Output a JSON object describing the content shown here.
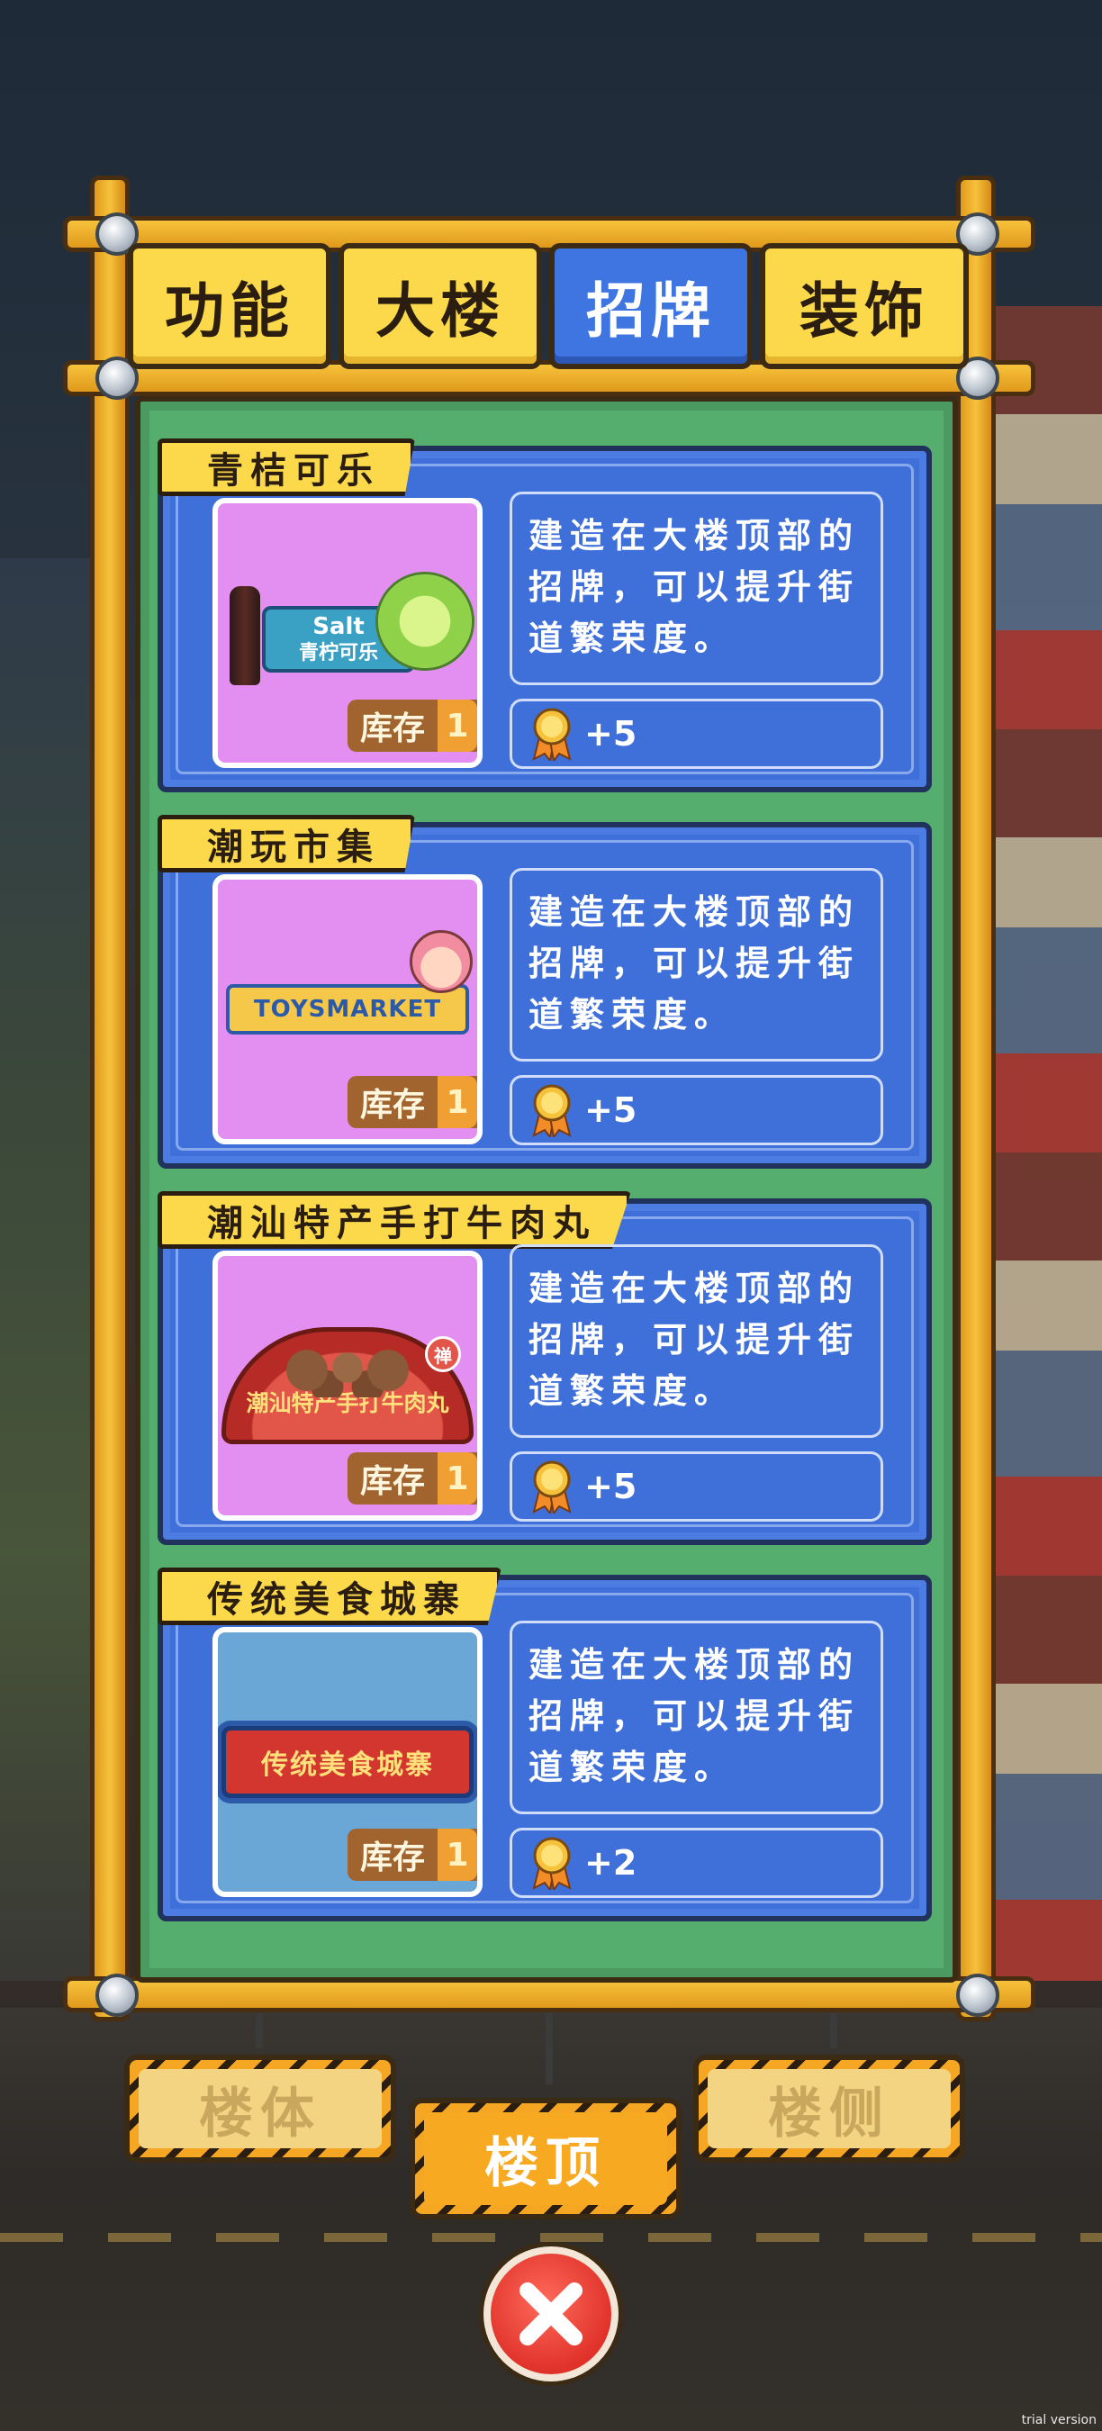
{
  "tabs": [
    {
      "label": "功能",
      "active": false
    },
    {
      "label": "大楼",
      "active": false
    },
    {
      "label": "招牌",
      "active": true
    },
    {
      "label": "装饰",
      "active": false
    }
  ],
  "stock_label": "库存",
  "signs": [
    {
      "title": "青桔可乐",
      "sign_text_line1": "Salt",
      "sign_text_line2": "青柠可乐",
      "stock": "1",
      "description": "建造在大楼顶部的招牌，可以提升街道繁荣度。",
      "reward": "+5",
      "thumb_color": "#e38ff1"
    },
    {
      "title": "潮玩市集",
      "sign_text_line1": "TOYSMARKET",
      "stock": "1",
      "description": "建造在大楼顶部的招牌，可以提升街道繁荣度。",
      "reward": "+5",
      "thumb_color": "#e38ff1"
    },
    {
      "title": "潮汕特产手打牛肉丸",
      "sign_text_line1": "潮汕特产手打牛肉丸",
      "sign_badge": "禅",
      "stock": "1",
      "description": "建造在大楼顶部的招牌，可以提升街道繁荣度。",
      "reward": "+5",
      "thumb_color": "#e38ff1"
    },
    {
      "title": "传统美食城寨",
      "sign_text_line1": "传统美食城寨",
      "stock": "1",
      "description": "建造在大楼顶部的招牌，可以提升街道繁荣度。",
      "reward": "+2",
      "thumb_color": "#6aa6d6"
    }
  ],
  "placement_buttons": [
    {
      "label": "楼体",
      "selected": false
    },
    {
      "label": "楼顶",
      "selected": true
    },
    {
      "label": "楼侧",
      "selected": false
    }
  ],
  "close_icon": "close-x-icon",
  "reward_icon": "prosperity-medal-icon",
  "watermark": "trial version",
  "colors": {
    "tab_active": "#3f75e0",
    "tab_inactive": "#fbd94a",
    "board_green": "#55ad6e",
    "card_blue": "#3f6fd8",
    "button_active": "#f7a921",
    "close_red": "#e0322a"
  }
}
